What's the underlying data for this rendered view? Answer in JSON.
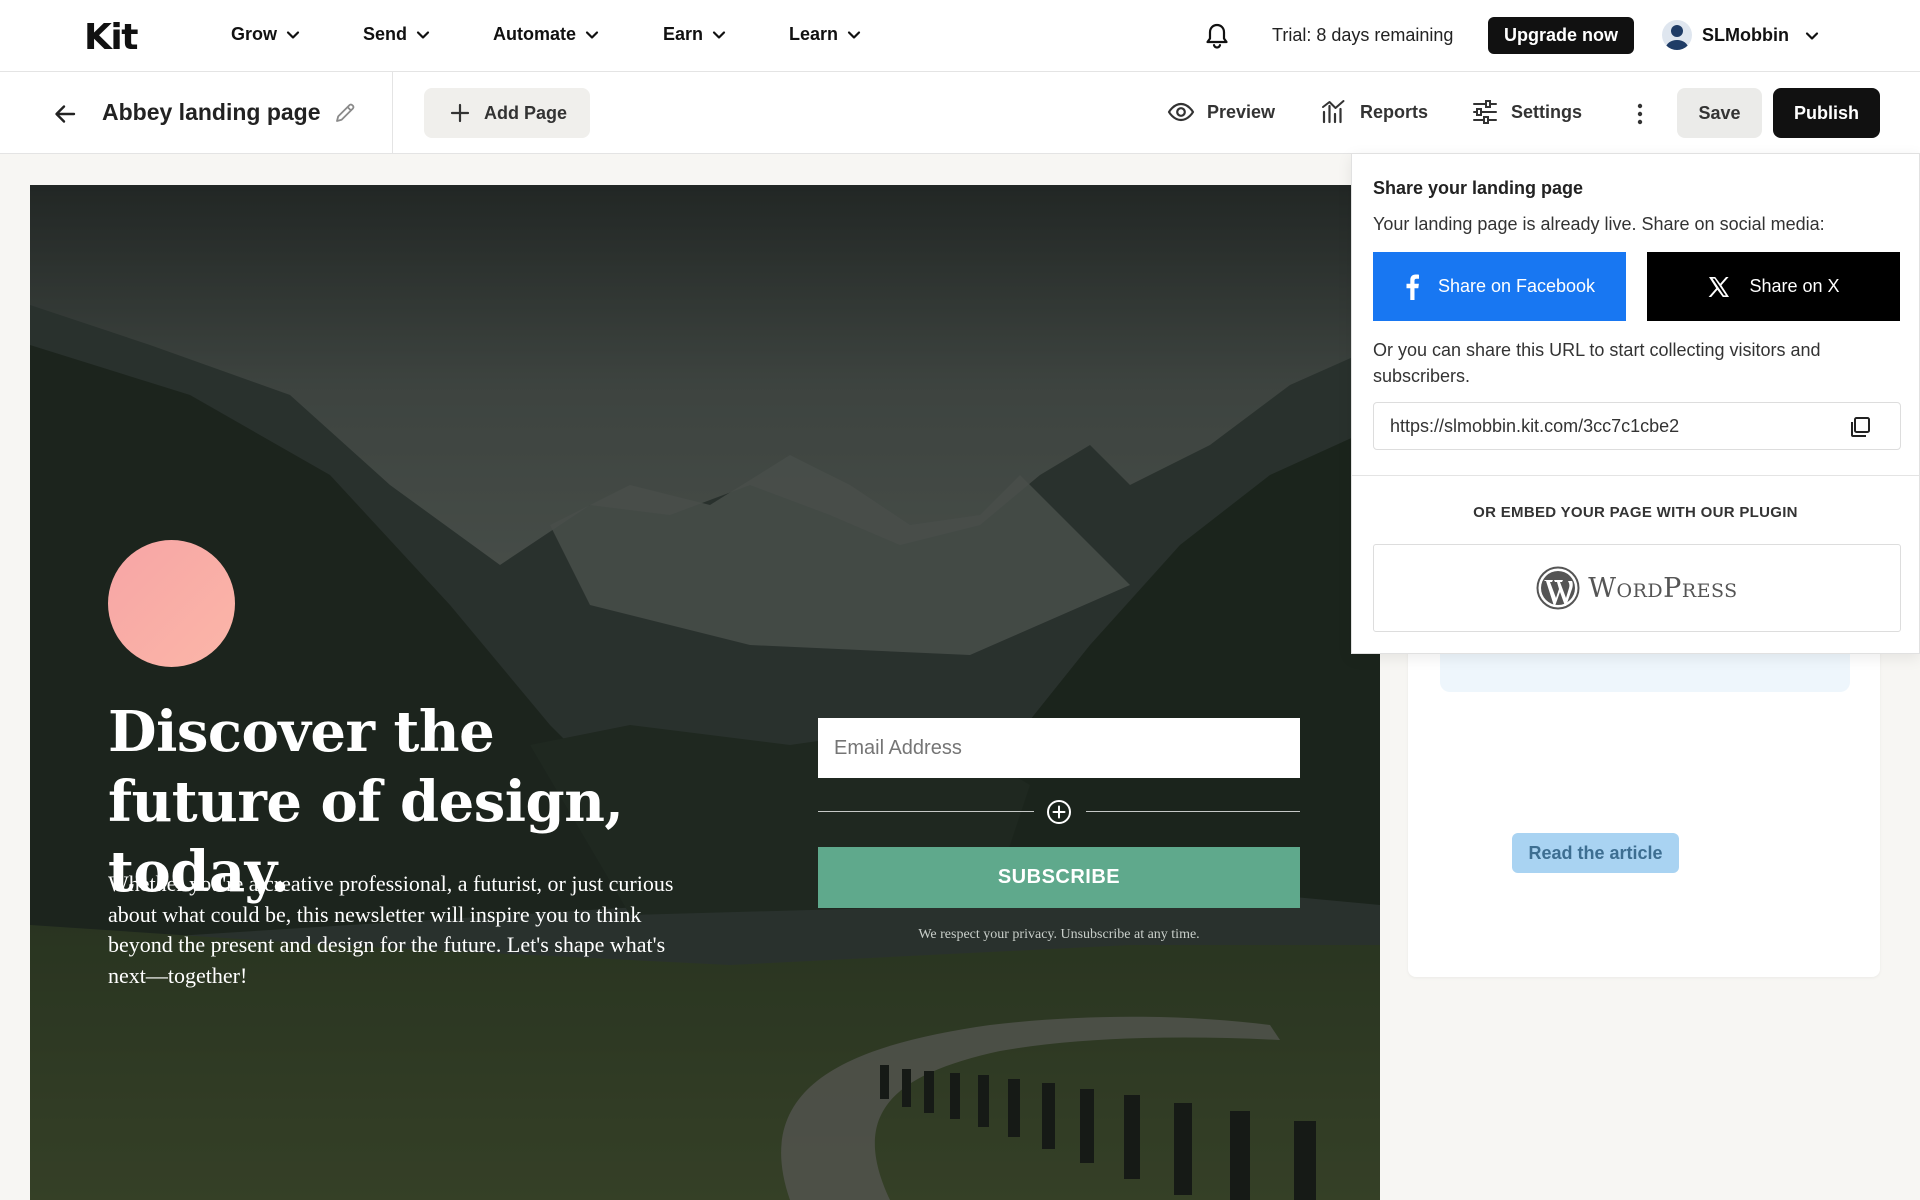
{
  "topnav": {
    "logo": "Kit",
    "items": [
      {
        "label": "Grow"
      },
      {
        "label": "Send"
      },
      {
        "label": "Automate"
      },
      {
        "label": "Earn"
      },
      {
        "label": "Learn"
      }
    ],
    "trial_text": "Trial: 8 days remaining",
    "upgrade_label": "Upgrade now",
    "username": "SLMobbin"
  },
  "toolbar": {
    "page_title": "Abbey landing page",
    "add_page_label": "Add Page",
    "preview_label": "Preview",
    "reports_label": "Reports",
    "settings_label": "Settings",
    "save_label": "Save",
    "publish_label": "Publish"
  },
  "landing": {
    "headline": "Discover the future of design, today.",
    "description": "Whether you're a creative professional, a futurist, or just curious about what could be, this newsletter will inspire you to think beyond the present and design for the future. Let's shape what's next—together!",
    "email_placeholder": "Email Address",
    "subscribe_label": "SUBSCRIBE",
    "privacy_text": "We respect your privacy. Unsubscribe at any time.",
    "avatar_color": "#f7a5a5",
    "button_color": "#5fa98c"
  },
  "sidepanel": {
    "read_article_label": "Read the article"
  },
  "share": {
    "title": "Share your landing page",
    "subtitle": "Your landing page is already live. Share on social media:",
    "facebook_label": "Share on Facebook",
    "x_label": "Share on X",
    "url_hint": "Or you can share this URL to start collecting visitors and subscribers.",
    "url": "https://slmobbin.kit.com/3cc7c1cbe2",
    "embed_label": "OR EMBED YOUR PAGE WITH OUR PLUGIN",
    "wordpress_label": "WordPress",
    "facebook_color": "#1877f2",
    "x_color": "#000000"
  },
  "icons": {
    "nav_chevron": "chevron-down-icon",
    "bell": "bell-icon",
    "back": "arrow-left-icon",
    "edit": "pencil-icon",
    "add": "plus-icon",
    "preview": "eye-icon",
    "reports": "bar-chart-icon",
    "settings": "sliders-icon",
    "more": "kebab-menu-icon",
    "copy": "copy-icon",
    "add_block": "plus-circle-icon"
  }
}
